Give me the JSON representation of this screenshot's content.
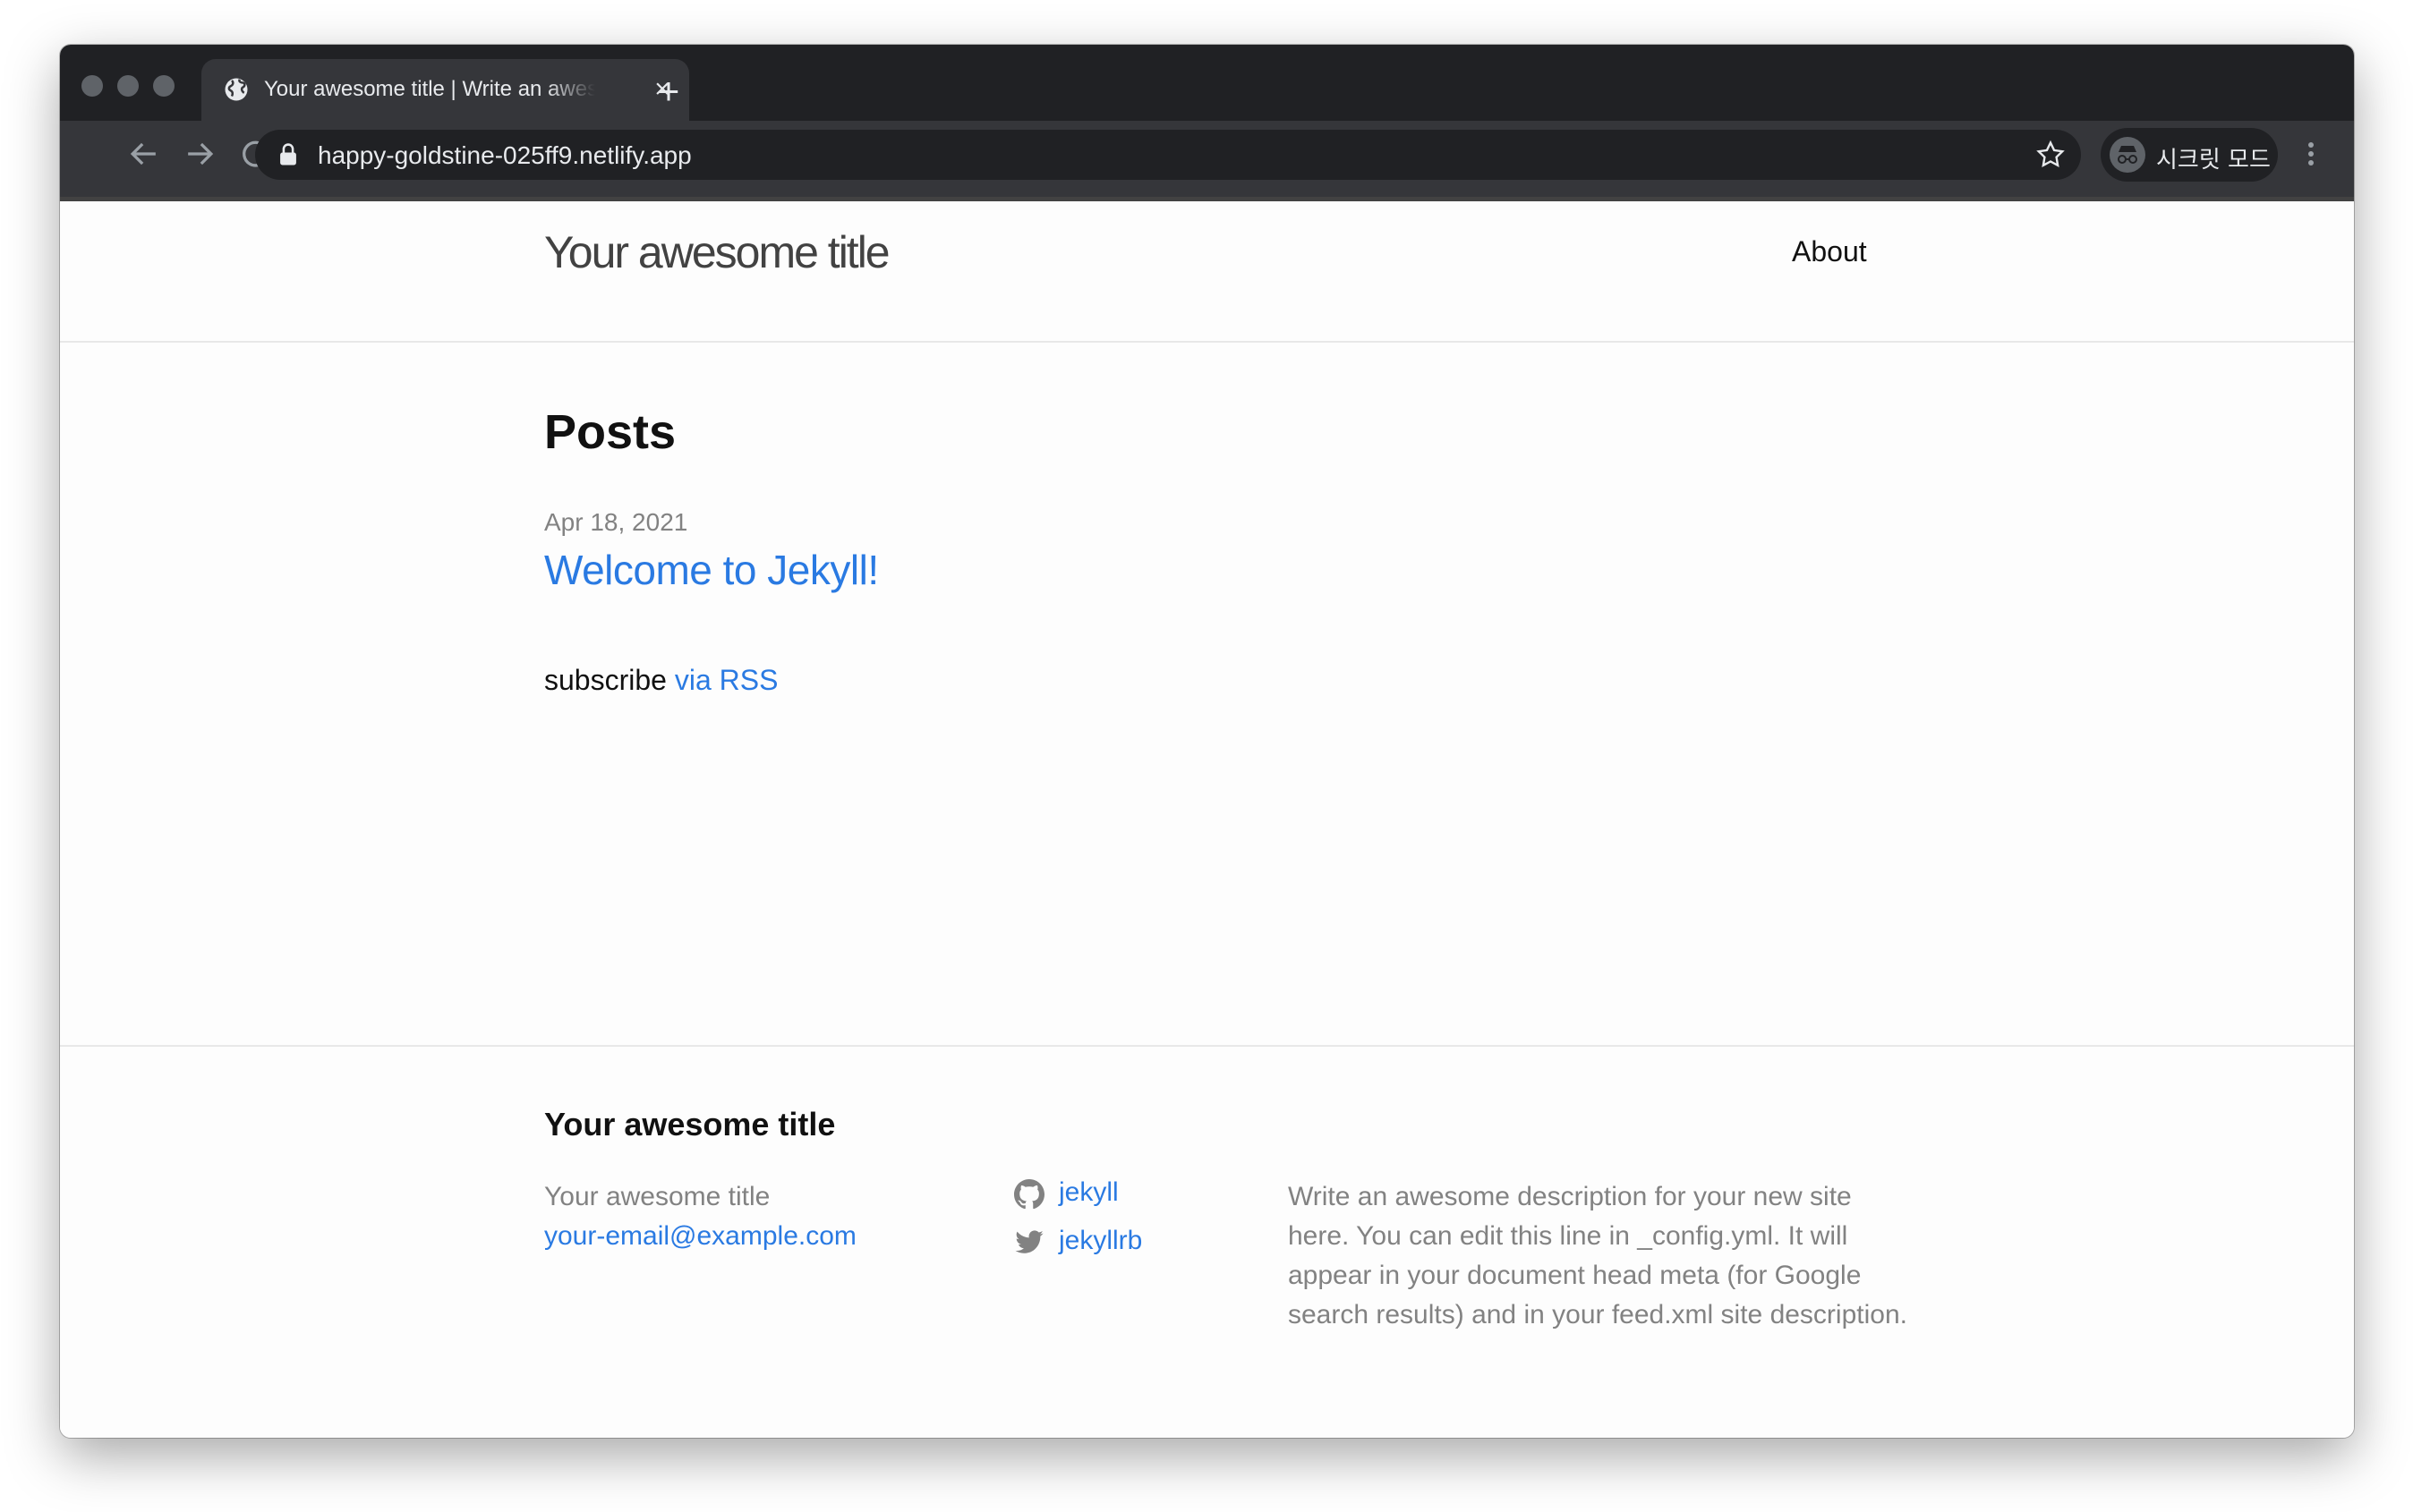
{
  "browser": {
    "tab_title": "Your awesome title | Write an awesome description",
    "url": "happy-goldstine-025ff9.netlify.app",
    "incognito_label": "시크릿 모드",
    "icons": {
      "back": "back-arrow-icon",
      "forward": "forward-arrow-icon",
      "reload": "reload-icon",
      "lock": "lock-icon",
      "bookmark": "star-icon",
      "menu": "three-dots-icon",
      "new_tab": "plus-icon",
      "close_tab": "close-icon"
    }
  },
  "header": {
    "site_title": "Your awesome title",
    "nav": [
      {
        "label": "About"
      }
    ]
  },
  "main": {
    "heading": "Posts",
    "posts": [
      {
        "date": "Apr 18, 2021",
        "title": "Welcome to Jekyll!"
      }
    ],
    "subscribe_text": "subscribe",
    "subscribe_link": "via RSS"
  },
  "footer": {
    "heading": "Your awesome title",
    "site_name": "Your awesome title",
    "email": "your-email@example.com",
    "social": [
      {
        "icon": "github-icon",
        "label": "jekyll"
      },
      {
        "icon": "twitter-icon",
        "label": "jekyllrb"
      }
    ],
    "description": "Write an awesome description for your new site here. You can edit this line in _config.yml. It will appear in your document head meta (for Google search results) and in your feed.xml site description."
  },
  "colors": {
    "link": "#2a7ae2",
    "text": "#111111",
    "muted": "#828282",
    "chrome_dark": "#202124",
    "chrome_toolbar": "#35363a"
  }
}
